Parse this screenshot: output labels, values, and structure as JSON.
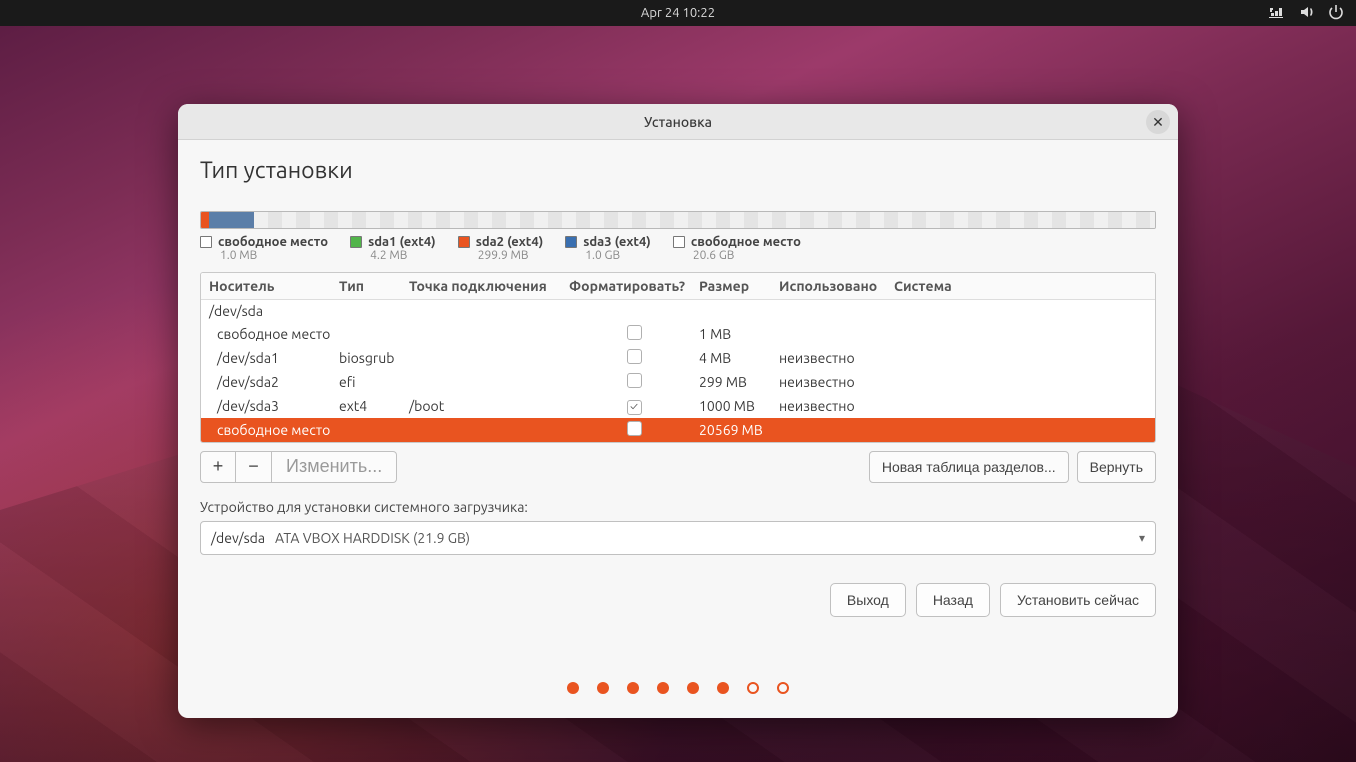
{
  "topbar": {
    "datetime": "Apr 24  10:22"
  },
  "window": {
    "title": "Установка"
  },
  "page": {
    "heading": "Тип установки"
  },
  "partitions_bar": [
    {
      "color": "#e95420",
      "width_pct": 0.8
    },
    {
      "color": "#5b7ea8",
      "width_pct": 4.8
    },
    {
      "color": "#cccccc",
      "width_pct": 94.4
    }
  ],
  "legend": [
    {
      "color": "#ffffff",
      "label": "свободное место",
      "sub": "1.0 MB"
    },
    {
      "color": "#51b44a",
      "label": "sda1 (ext4)",
      "sub": "4.2 MB"
    },
    {
      "color": "#e95420",
      "label": "sda2 (ext4)",
      "sub": "299.9 MB"
    },
    {
      "color": "#3a6fb0",
      "label": "sda3 (ext4)",
      "sub": "1.0 GB"
    },
    {
      "color": "#ffffff",
      "label": "свободное место",
      "sub": "20.6 GB"
    }
  ],
  "columns": {
    "device": "Носитель",
    "type": "Тип",
    "mount": "Точка подключения",
    "format": "Форматировать?",
    "size": "Размер",
    "used": "Использовано",
    "system": "Система"
  },
  "disk": "/dev/sda",
  "rows": [
    {
      "device": "свободное место",
      "type": "",
      "mount": "",
      "format": false,
      "size": "1 MB",
      "used": "",
      "system": "",
      "selected": false
    },
    {
      "device": "/dev/sda1",
      "type": "biosgrub",
      "mount": "",
      "format": false,
      "size": "4 MB",
      "used": "неизвестно",
      "system": "",
      "selected": false
    },
    {
      "device": "/dev/sda2",
      "type": "efi",
      "mount": "",
      "format": false,
      "size": "299 MB",
      "used": "неизвестно",
      "system": "",
      "selected": false
    },
    {
      "device": "/dev/sda3",
      "type": "ext4",
      "mount": "/boot",
      "format": true,
      "size": "1000 MB",
      "used": "неизвестно",
      "system": "",
      "selected": false
    },
    {
      "device": "свободное место",
      "type": "",
      "mount": "",
      "format": false,
      "size": "20569 MB",
      "used": "",
      "system": "",
      "selected": true
    }
  ],
  "toolbar": {
    "add": "+",
    "remove": "−",
    "change": "Изменить...",
    "new_table": "Новая таблица разделов...",
    "revert": "Вернуть"
  },
  "bootloader": {
    "label": "Устройство для установки системного загрузчика:",
    "device": "/dev/sda",
    "desc": "ATA VBOX HARDDISK (21.9 GB)"
  },
  "actions": {
    "quit": "Выход",
    "back": "Назад",
    "install": "Установить сейчас"
  },
  "progress": {
    "total": 8,
    "current": 6
  }
}
